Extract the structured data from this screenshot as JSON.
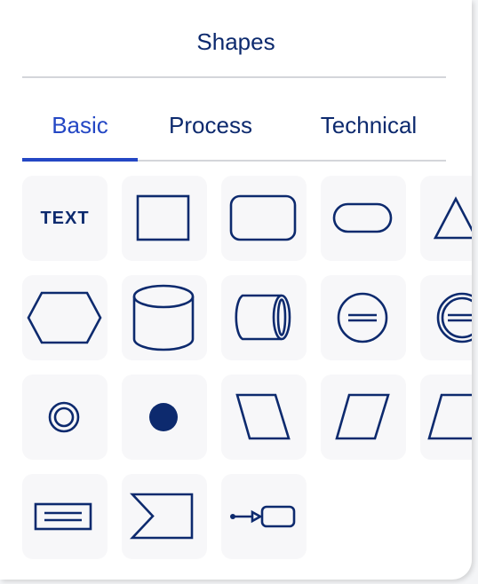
{
  "panel": {
    "title": "Shapes",
    "tabs": [
      {
        "label": "Basic",
        "active": true
      },
      {
        "label": "Process",
        "active": false
      },
      {
        "label": "Technical",
        "active": false
      }
    ]
  },
  "shapes": [
    {
      "name": "text",
      "label": "TEXT"
    },
    {
      "name": "rectangle"
    },
    {
      "name": "rounded-rectangle"
    },
    {
      "name": "pill"
    },
    {
      "name": "triangle"
    },
    {
      "name": "hexagon"
    },
    {
      "name": "cylinder"
    },
    {
      "name": "horizontal-cylinder"
    },
    {
      "name": "circle-divided"
    },
    {
      "name": "double-circle-divided"
    },
    {
      "name": "double-circle"
    },
    {
      "name": "filled-circle"
    },
    {
      "name": "parallelogram-left"
    },
    {
      "name": "parallelogram-right"
    },
    {
      "name": "trapezoid"
    },
    {
      "name": "note-card"
    },
    {
      "name": "chevron-step"
    },
    {
      "name": "connector-node"
    }
  ],
  "colors": {
    "accent": "#2447c4",
    "ink": "#0d2a6e",
    "tile": "#f7f7f9",
    "divider": "#d4d6da"
  }
}
